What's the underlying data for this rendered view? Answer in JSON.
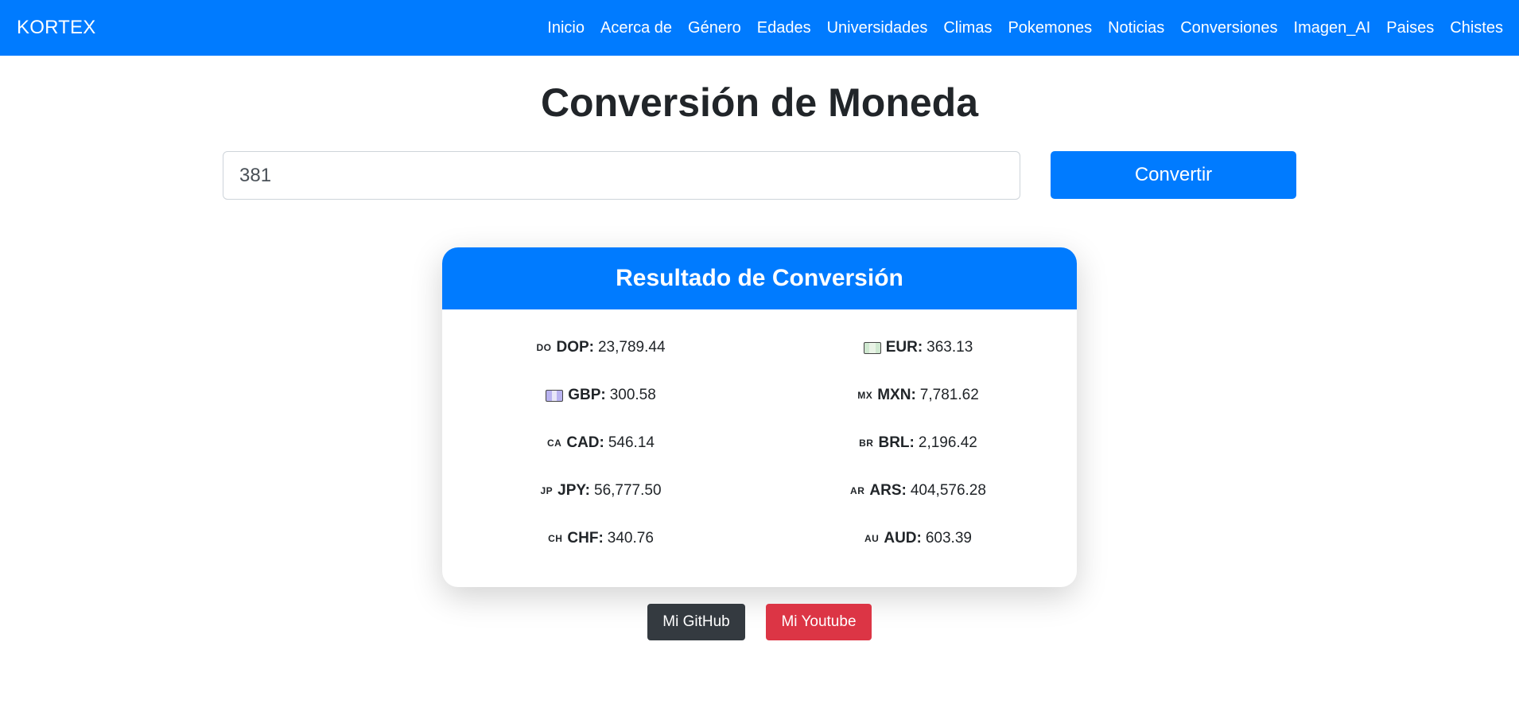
{
  "navbar": {
    "brand": "KORTEX",
    "links": [
      "Inicio",
      "Acerca de",
      "Género",
      "Edades",
      "Universidades",
      "Climas",
      "Pokemones",
      "Noticias",
      "Conversiones",
      "Imagen_AI",
      "Paises",
      "Chistes"
    ]
  },
  "page": {
    "title": "Conversión de Moneda"
  },
  "form": {
    "amount_value": "381",
    "convert_label": "Convertir"
  },
  "result": {
    "header": "Resultado de Conversión",
    "rates": [
      {
        "flag": "DO",
        "code": "DOP:",
        "value": "23,789.44"
      },
      {
        "flag": "eur-flag-icon",
        "code": "EUR:",
        "value": "363.13"
      },
      {
        "flag": "gbp-flag-icon",
        "code": "GBP:",
        "value": "300.58"
      },
      {
        "flag": "MX",
        "code": "MXN:",
        "value": "7,781.62"
      },
      {
        "flag": "CA",
        "code": "CAD:",
        "value": "546.14"
      },
      {
        "flag": "BR",
        "code": "BRL:",
        "value": "2,196.42"
      },
      {
        "flag": "JP",
        "code": "JPY:",
        "value": "56,777.50"
      },
      {
        "flag": "AR",
        "code": "ARS:",
        "value": "404,576.28"
      },
      {
        "flag": "CH",
        "code": "CHF:",
        "value": "340.76"
      },
      {
        "flag": "AU",
        "code": "AUD:",
        "value": "603.39"
      }
    ]
  },
  "footer": {
    "github_label": "Mi GitHub",
    "youtube_label": "Mi Youtube"
  },
  "colors": {
    "primary": "#007bff",
    "dark": "#343a40",
    "danger": "#dc3545"
  }
}
